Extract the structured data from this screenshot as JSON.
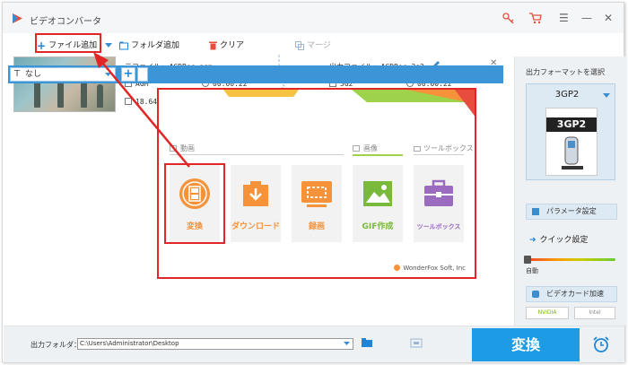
{
  "app": {
    "title": "ビデオコンバータ"
  },
  "toolbar": {
    "add_file": "ファイル追加",
    "add_folder": "フォルダ追加",
    "clear": "クリア",
    "merge": "マージ"
  },
  "file_item": {
    "source_label": "元ファイル: AGDRec.agm",
    "output_label": "出力ファイル: AGDRec.3g2",
    "source_format": "AGM",
    "output_format": "3G2",
    "source_duration": "00:00:22",
    "output_duration": "00:00:22",
    "source_size": "18.64",
    "subtitle_value": "なし"
  },
  "popup": {
    "categories": {
      "video": "動画",
      "image": "画像",
      "toolbox": "ツールボックス"
    },
    "tiles": [
      {
        "label": "変換",
        "color": "#f5923a"
      },
      {
        "label": "ダウンロード",
        "color": "#f5923a"
      },
      {
        "label": "録画",
        "color": "#f5923a"
      },
      {
        "label": "GIF作成",
        "color": "#79b93c"
      },
      {
        "label": "ツールボックス",
        "color": "#9a6bbf"
      }
    ],
    "copyright": "WonderFox Soft, Inc"
  },
  "right_panel": {
    "title": "出力フォーマットを選択",
    "format": "3GP2",
    "format_badge": "3GP2",
    "param_settings": "パラメータ設定",
    "quick_settings": "クイック設定",
    "auto": "自動",
    "gpu_accel": "ビデオカード加速",
    "nvidia": "NVIDIA",
    "intel": "Intel"
  },
  "bottom": {
    "output_folder_label": "出力フォルダ：",
    "output_path": "C:\\Users\\Administrator\\Desktop",
    "convert": "変換"
  },
  "colors": {
    "accent": "#1e9be5",
    "highlight": "#e22525",
    "orange": "#f5923a"
  }
}
